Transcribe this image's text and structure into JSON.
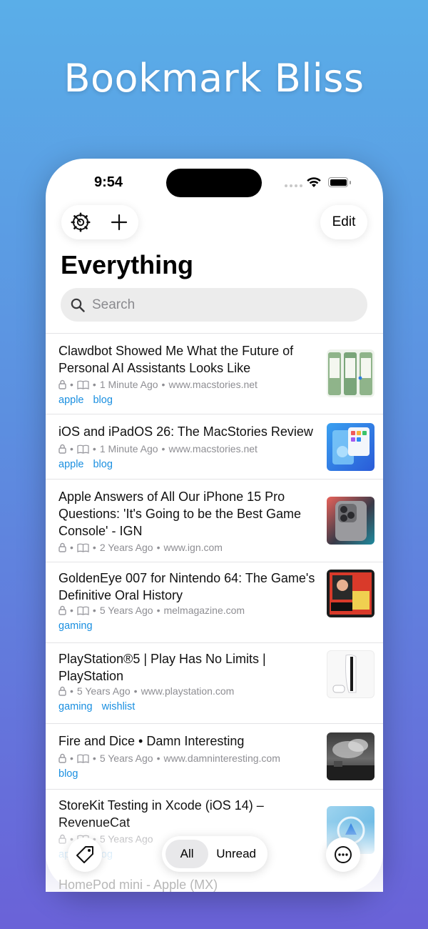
{
  "headline": "Bookmark Bliss",
  "status_bar": {
    "time": "9:54"
  },
  "toolbar": {
    "settings_icon": "gear-icon",
    "add_icon": "plus-icon",
    "edit_label": "Edit"
  },
  "page": {
    "title": "Everything"
  },
  "search": {
    "placeholder": "Search"
  },
  "bookmarks": [
    {
      "title": "Clawdbot Showed Me What the Future of Personal AI Assistants Looks Like",
      "age": "1 Minute Ago",
      "domain": "www.macstories.net",
      "tags": [
        "apple",
        "blog"
      ],
      "reader_icon": true
    },
    {
      "title": "iOS and iPadOS 26: The MacStories Review",
      "age": "1 Minute Ago",
      "domain": "www.macstories.net",
      "tags": [
        "apple",
        "blog"
      ],
      "reader_icon": true
    },
    {
      "title": "Apple Answers of All Our iPhone 15 Pro Questions: 'It's Going to be the Best Game Console' - IGN",
      "age": "2 Years Ago",
      "domain": "www.ign.com",
      "tags": [],
      "reader_icon": true
    },
    {
      "title": "GoldenEye 007 for Nintendo 64: The Game's Definitive Oral History",
      "age": "5 Years Ago",
      "domain": "melmagazine.com",
      "tags": [
        "gaming"
      ],
      "reader_icon": true
    },
    {
      "title": "PlayStation®5 | Play Has No Limits | PlayStation",
      "age": "5 Years Ago",
      "domain": "www.playstation.com",
      "tags": [
        "gaming",
        "wishlist"
      ],
      "reader_icon": false
    },
    {
      "title": "Fire and Dice • Damn Interesting",
      "age": "5 Years Ago",
      "domain": "www.damninteresting.com",
      "tags": [
        "blog"
      ],
      "reader_icon": true
    },
    {
      "title": "StoreKit Testing in Xcode (iOS 14) – RevenueCat",
      "age": "5 Years Ago",
      "domain": "",
      "tags": [
        "apple",
        "blog"
      ],
      "reader_icon": true
    }
  ],
  "next_partial_title": "HomePod mini - Apple (MX)",
  "bottom_bar": {
    "filter_all": "All",
    "filter_unread": "Unread",
    "tags_icon": "tag-icon",
    "more_icon": "ellipsis-circle-icon"
  },
  "colors": {
    "accent": "#1a8fe0",
    "meta": "#8e8e93"
  }
}
